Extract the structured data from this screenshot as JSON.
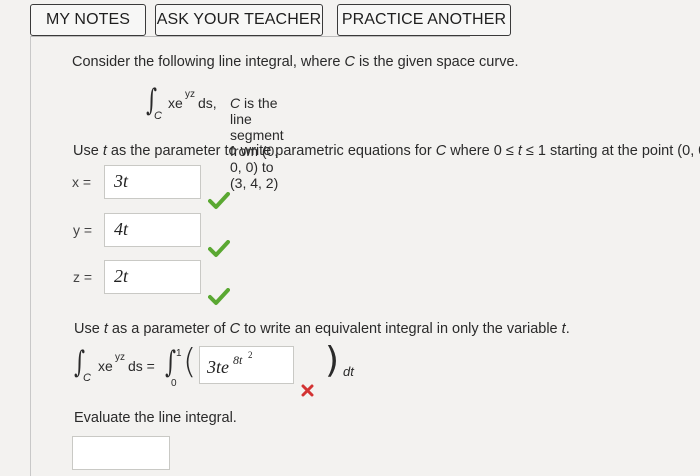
{
  "tabs": {
    "my_notes": "MY NOTES",
    "ask_teacher": "ASK YOUR TEACHER",
    "practice_another": "PRACTICE ANOTHER"
  },
  "problem": {
    "intro_prefix": "Consider the following line integral, where ",
    "intro_var": "C",
    "intro_suffix": " is the given space curve.",
    "integrand_x": "xe",
    "integrand_exp": "yz",
    "integrand_ds": " ds,",
    "integral_sub": "C",
    "curve_prefix": "C",
    "curve_text": " is the line segment from (0, 0, 0) to (3, 4, 2)",
    "param_part1": "Use ",
    "param_t": "t",
    "param_part2": " as the parameter to write parametric equations for ",
    "param_C": "C",
    "param_part3": " where 0 ≤ ",
    "param_t2": "t",
    "param_part4": " ≤ 1 starting at the point (0, 0",
    "equiv_part1": "Use ",
    "equiv_t": "t",
    "equiv_part2": " as a parameter of ",
    "equiv_C": "C",
    "equiv_part3": " to write an equivalent integral in only the variable ",
    "equiv_t2": "t",
    "equiv_part4": ".",
    "evaluate": "Evaluate the line integral."
  },
  "answers": {
    "x_label": "x =",
    "x_value": "3t",
    "y_label": "y =",
    "y_value": "4t",
    "z_label": "z =",
    "z_value": "2t",
    "integral_lhs": "xe",
    "integral_lhs_exp": "yz",
    "integral_lhs_ds": " ds =",
    "upper_limit": "1",
    "lower_limit": "0",
    "integrand_value": "3te",
    "integrand_exp": "8t",
    "integrand_exp_pow": "2",
    "dt": "dt",
    "final_value": ""
  },
  "status": {
    "x": "correct",
    "y": "correct",
    "z": "correct",
    "integrand": "incorrect"
  },
  "colors": {
    "correct": "#5aa832",
    "incorrect": "#d33333"
  }
}
